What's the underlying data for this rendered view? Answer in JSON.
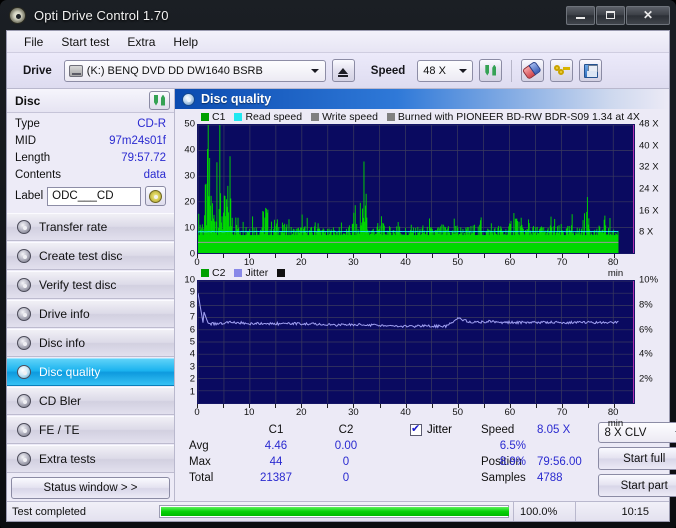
{
  "window": {
    "title": "Opti Drive Control 1.70",
    "icon": "disc-icon",
    "controls": {
      "minimize": "–",
      "maximize": "□",
      "close": "✕"
    }
  },
  "menu": {
    "items": [
      "File",
      "Start test",
      "Extra",
      "Help"
    ]
  },
  "toolbar": {
    "drive_label": "Drive",
    "drive_value": "(K:)  BENQ DVD DD DW1640 BSRB",
    "eject_icon": "eject-icon",
    "speed_label": "Speed",
    "speed_value": "48 X",
    "refresh_icon": "refresh-icon",
    "eraser_icon": "eraser-icon",
    "keys_icon": "keys-icon",
    "save_icon": "save-icon"
  },
  "disc": {
    "title": "Disc",
    "refresh_icon": "refresh-icon",
    "rows": [
      {
        "key": "Type",
        "value": "CD-R"
      },
      {
        "key": "MID",
        "value": "97m24s01f"
      },
      {
        "key": "Length",
        "value": "79:57.72"
      },
      {
        "key": "Contents",
        "value": "data"
      }
    ],
    "label_key": "Label",
    "label_value": "ODC___CD",
    "label_placeholder": "",
    "disc_icon": "cd-icon"
  },
  "sidebar": {
    "items": [
      {
        "label": "Transfer rate",
        "icon": "disc-icon",
        "selected": false
      },
      {
        "label": "Create test disc",
        "icon": "disc-icon",
        "selected": false
      },
      {
        "label": "Verify test disc",
        "icon": "disc-icon",
        "selected": false
      },
      {
        "label": "Drive info",
        "icon": "disc-icon",
        "selected": false
      },
      {
        "label": "Disc info",
        "icon": "disc-icon",
        "selected": false
      },
      {
        "label": "Disc quality",
        "icon": "disc-icon",
        "selected": true
      },
      {
        "label": "CD Bler",
        "icon": "disc-icon",
        "selected": false
      },
      {
        "label": "FE / TE",
        "icon": "disc-icon",
        "selected": false
      },
      {
        "label": "Extra tests",
        "icon": "disc-icon",
        "selected": false
      }
    ],
    "status_button": "Status window > >"
  },
  "main": {
    "title": "Disc quality",
    "title_icon": "disc-icon",
    "legend": [
      {
        "label": "C1",
        "color": "#00a000"
      },
      {
        "label": "Read speed",
        "color": "#20e8f0"
      },
      {
        "label": "Write speed",
        "color": "#808080"
      },
      {
        "label": "Burned with PIONEER BD-RW   BDR-S09 1.34 at 4X",
        "color": "#808080"
      }
    ],
    "legend2": [
      {
        "label": "C2",
        "color": "#00a000"
      },
      {
        "label": "Jitter",
        "color": "#8888e8"
      },
      {
        "label": "",
        "color": "#000000"
      }
    ]
  },
  "chart_data": [
    {
      "type": "line",
      "name": "c1-chart",
      "title": "C1 errors vs read speed",
      "xlabel": "min",
      "ylabel": "C1",
      "y2label": "X",
      "xlim": [
        0,
        84
      ],
      "ylim": [
        0,
        50
      ],
      "y2lim": [
        0,
        48
      ],
      "yticks": [
        0,
        10,
        20,
        30,
        40,
        50
      ],
      "y2ticks": [
        "8 X",
        "16 X",
        "24 X",
        "32 X",
        "40 X",
        "48 X"
      ],
      "xticks": [
        "0",
        "10",
        "20",
        "30",
        "40",
        "50",
        "60",
        "70",
        "80 min"
      ],
      "grid": true,
      "legend_position": "top",
      "series": [
        {
          "name": "C1",
          "color": "#00d800",
          "type": "impulse",
          "x": [
            0,
            1,
            2,
            3,
            4,
            5,
            6,
            7,
            8,
            9,
            10,
            11,
            12,
            13,
            14,
            15,
            16,
            17,
            18,
            19,
            20,
            21,
            22,
            23,
            24,
            25,
            26,
            27,
            28,
            29,
            30,
            31,
            32,
            33,
            34,
            35,
            36,
            37,
            38,
            39,
            40,
            41,
            42,
            43,
            44,
            45,
            46,
            47,
            48,
            49,
            50,
            51,
            52,
            53,
            54,
            55,
            56,
            57,
            58,
            59,
            60,
            61,
            62,
            63,
            64,
            65,
            66,
            67,
            68,
            69,
            70,
            71,
            72,
            73,
            74,
            75,
            76,
            77,
            78,
            79,
            80
          ],
          "values": [
            14,
            12,
            44,
            16,
            32,
            20,
            27,
            14,
            12,
            11,
            11,
            9,
            10,
            20,
            10,
            12,
            9,
            9,
            8,
            8,
            9,
            8,
            8,
            9,
            8,
            7,
            8,
            8,
            7,
            8,
            11,
            9,
            22,
            8,
            9,
            10,
            9,
            8,
            9,
            9,
            8,
            7,
            8,
            9,
            8,
            8,
            8,
            9,
            8,
            8,
            9,
            8,
            8,
            9,
            9,
            8,
            8,
            8,
            9,
            8,
            9,
            18,
            9,
            8,
            9,
            8,
            9,
            8,
            9,
            8,
            9,
            8,
            9,
            8,
            9,
            20,
            8,
            8,
            9,
            8,
            7
          ],
          "baseline": 7
        },
        {
          "name": "Read speed",
          "color": "#20e8f0",
          "type": "line",
          "x": [
            0,
            10,
            20,
            30,
            40,
            50,
            60,
            70,
            80
          ],
          "values": [
            8.0,
            8.05,
            8.05,
            8.05,
            8.05,
            8.05,
            8.05,
            8.05,
            8.05
          ],
          "unit": "X"
        },
        {
          "name": "Write speed",
          "color": "#9a9a9a",
          "type": "line",
          "x": [
            0,
            10,
            20,
            30,
            40,
            50,
            60,
            70,
            80
          ],
          "values": [
            4,
            4,
            4,
            4,
            4,
            4,
            4,
            4,
            4
          ],
          "unit": "X"
        }
      ]
    },
    {
      "type": "line",
      "name": "c2-jitter-chart",
      "title": "C2 errors and jitter",
      "xlabel": "min",
      "ylabel": "C2",
      "y2label": "%",
      "xlim": [
        0,
        84
      ],
      "ylim": [
        0,
        10
      ],
      "y2lim": [
        0,
        10
      ],
      "yticks": [
        1,
        2,
        3,
        4,
        5,
        6,
        7,
        8,
        9,
        10
      ],
      "y2ticks": [
        "2%",
        "4%",
        "6%",
        "8%",
        "10%"
      ],
      "xticks": [
        "0",
        "10",
        "20",
        "30",
        "40",
        "50",
        "60",
        "70",
        "80 min"
      ],
      "grid": true,
      "legend_position": "top",
      "series": [
        {
          "name": "C2",
          "color": "#00d800",
          "type": "impulse",
          "x": [],
          "values": []
        },
        {
          "name": "Jitter",
          "color": "#9f9ff0",
          "type": "line",
          "x": [
            0,
            2,
            4,
            6,
            8,
            10,
            12,
            14,
            16,
            18,
            20,
            22,
            24,
            26,
            28,
            30,
            32,
            34,
            36,
            38,
            40,
            42,
            44,
            46,
            48,
            50,
            52,
            54,
            56,
            58,
            60,
            62,
            64,
            66,
            68,
            70,
            72,
            74,
            76,
            78,
            80
          ],
          "values": [
            9.0,
            6.5,
            6.5,
            6.6,
            6.6,
            6.5,
            6.5,
            6.5,
            6.5,
            6.5,
            6.5,
            6.5,
            6.4,
            6.4,
            6.4,
            6.4,
            6.4,
            6.4,
            6.3,
            6.3,
            6.3,
            6.3,
            6.3,
            6.3,
            6.3,
            7.0,
            6.7,
            6.6,
            6.7,
            6.6,
            6.6,
            6.6,
            6.6,
            6.6,
            6.6,
            6.6,
            6.6,
            6.6,
            6.6,
            6.6,
            6.6
          ],
          "unit": "%"
        }
      ]
    }
  ],
  "stats": {
    "headers": [
      "",
      "C1",
      "C2"
    ],
    "rows": [
      {
        "key": "Avg",
        "c1": "4.46",
        "c2": "0.00"
      },
      {
        "key": "Max",
        "c1": "44",
        "c2": "0"
      },
      {
        "key": "Total",
        "c1": "21387",
        "c2": "0"
      }
    ],
    "jitter": {
      "checked": true,
      "label": "Jitter",
      "avg": "6.5%",
      "max": "8.9%",
      "total": ""
    }
  },
  "results": {
    "speed_key": "Speed",
    "speed_value": "8.05 X",
    "position_key": "Position",
    "position_value": "79:56.00",
    "samples_key": "Samples",
    "samples_value": "4788",
    "clv_value": "8 X CLV",
    "start_full": "Start full",
    "start_part": "Start part"
  },
  "statusbar": {
    "message": "Test completed",
    "progress_percent": "100.0%",
    "progress_value": 100,
    "elapsed": "10:15"
  }
}
